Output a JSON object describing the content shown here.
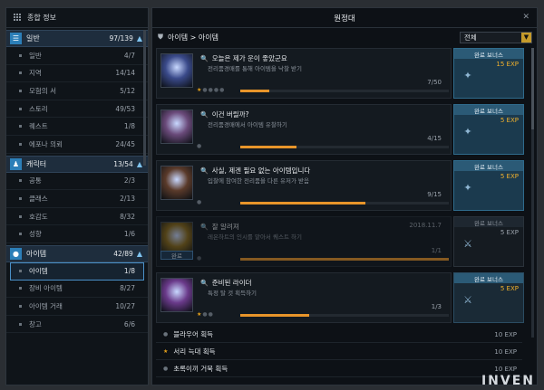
{
  "left": {
    "title": "종합 정보",
    "categories": [
      {
        "label": "일반",
        "count": "97/139",
        "icon": "list-icon",
        "items": [
          {
            "label": "일반",
            "count": "4/7"
          },
          {
            "label": "지역",
            "count": "14/14"
          },
          {
            "label": "모험의 서",
            "count": "5/12"
          },
          {
            "label": "스토리",
            "count": "49/53"
          },
          {
            "label": "퀘스트",
            "count": "1/8"
          },
          {
            "label": "에포나 의뢰",
            "count": "24/45"
          }
        ]
      },
      {
        "label": "캐릭터",
        "count": "13/54",
        "icon": "person-icon",
        "items": [
          {
            "label": "공통",
            "count": "2/3"
          },
          {
            "label": "클래스",
            "count": "2/13"
          },
          {
            "label": "호감도",
            "count": "8/32"
          },
          {
            "label": "성향",
            "count": "1/6"
          }
        ]
      },
      {
        "label": "아이템",
        "count": "42/89",
        "icon": "bag-icon",
        "items": [
          {
            "label": "아이템",
            "count": "1/8"
          },
          {
            "label": "장비 아이템",
            "count": "8/27"
          },
          {
            "label": "아이템 거래",
            "count": "10/27"
          },
          {
            "label": "창고",
            "count": "6/6"
          }
        ]
      }
    ]
  },
  "right": {
    "title": "원정대",
    "close": "✕",
    "breadcrumb": "아이템 > 아이템",
    "filter": "전체",
    "quests": [
      {
        "title": "오늘은 제가 운이 좋았군요",
        "desc": "전리품경매를 통해 아이템을 낙찰 받기",
        "progress": "7/50",
        "fill": 0.14,
        "stars_on": 1,
        "stars_off": 4,
        "date": "",
        "reward_label": "완료 보너스",
        "reward_exp": "15 EXP",
        "thumb": "#3a4a8a"
      },
      {
        "title": "이건 버릴까?",
        "desc": "전리품경매에서 아이템 유찰하기",
        "progress": "4/15",
        "fill": 0.27,
        "stars_on": 0,
        "stars_off": 1,
        "date": "",
        "reward_label": "완료 보너스",
        "reward_exp": "5 EXP",
        "thumb": "#6a4a7a"
      },
      {
        "title": "사실, 제겐 필요 없는 아이템입니다",
        "desc": "입찰에 참여한 전리품을 다른 유저가 받음",
        "progress": "9/15",
        "fill": 0.6,
        "stars_on": 0,
        "stars_off": 1,
        "date": "",
        "reward_label": "완료 보너스",
        "reward_exp": "5 EXP",
        "thumb": "#5a3a2a"
      },
      {
        "title": "잘 알려져",
        "desc": "레온하트의 인시를 맡아서 퀘스트 하기",
        "progress": "1/1",
        "fill": 1,
        "stars_on": 0,
        "stars_off": 1,
        "date": "2018.11.7",
        "reward_label": "완료 보너스",
        "reward_exp": "5 EXP",
        "thumb": "#8a6a1a",
        "done_tag": "완료"
      },
      {
        "title": "준비된 라이더",
        "desc": "특정 탈 것 획득하기",
        "progress": "1/3",
        "fill": 0.33,
        "stars_on": 1,
        "stars_off": 2,
        "date": "",
        "reward_label": "완료 보너스",
        "reward_exp": "5 EXP",
        "thumb": "#6a3a8a"
      }
    ],
    "simple": [
      {
        "title": "블라우어 획득",
        "exp": "10 EXP",
        "star": false
      },
      {
        "title": "서리 늑대 획득",
        "exp": "10 EXP",
        "star": true
      },
      {
        "title": "초록이끼 거북 획득",
        "exp": "10 EXP",
        "star": false
      }
    ]
  },
  "watermark": "INVEN"
}
